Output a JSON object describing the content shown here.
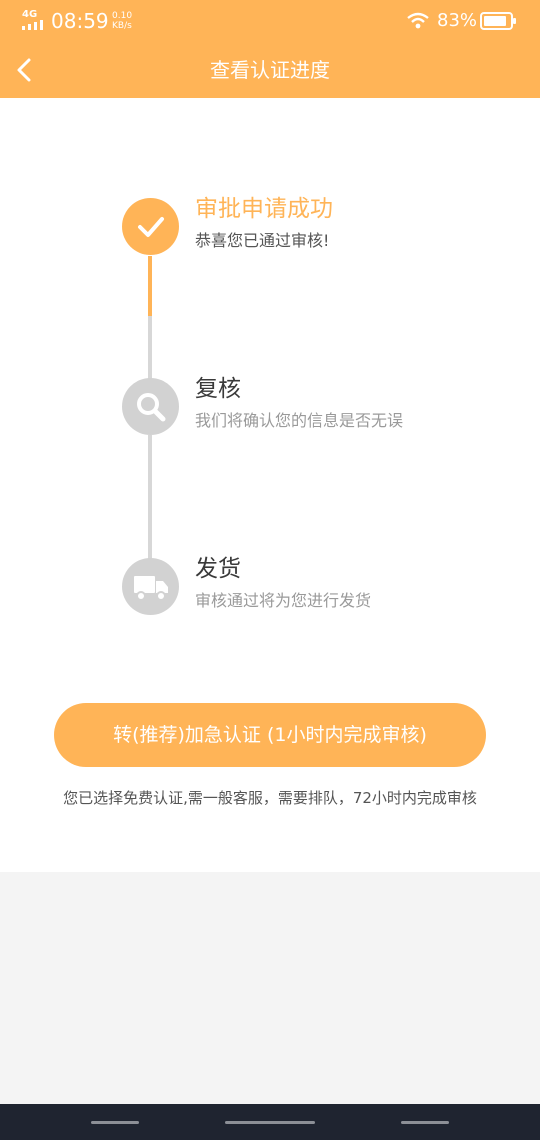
{
  "status_bar": {
    "network": "4G",
    "time": "08:59",
    "speed_value": "0.10",
    "speed_unit": "KB/s",
    "battery_percent": "83%"
  },
  "header": {
    "title": "查看认证进度",
    "back_icon": "chevron-left-icon"
  },
  "steps": [
    {
      "title": "审批申请成功",
      "desc": "恭喜您已通过审核!",
      "icon": "check-icon",
      "state": "completed"
    },
    {
      "title": "复核",
      "desc": "我们将确认您的信息是否无误",
      "icon": "search-icon",
      "state": "pending"
    },
    {
      "title": "发货",
      "desc": "审核通过将为您进行发货",
      "icon": "truck-icon",
      "state": "pending"
    }
  ],
  "cta": {
    "label": "转(推荐)加急认证 (1小时内完成审核)"
  },
  "note": "您已选择免费认证,需一般客服，需要排队，72小时内完成审核",
  "colors": {
    "accent": "#ffb457",
    "inactive_icon": "#d2d2d2",
    "page_bg": "#f4f4f4",
    "nav_bar": "#1f2430"
  }
}
